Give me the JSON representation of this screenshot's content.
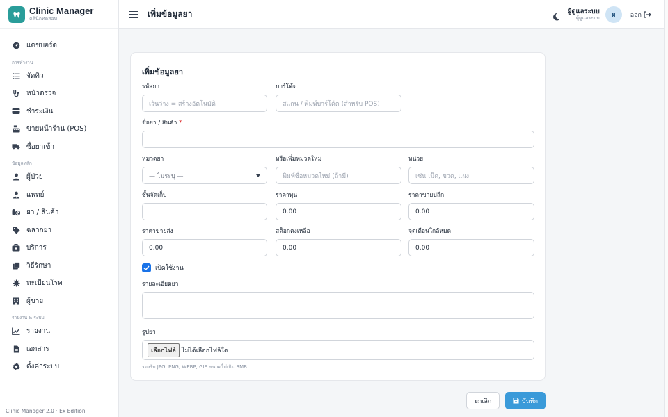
{
  "brand": {
    "title": "Clinic Manager",
    "subtitle": "คลินิกทดสอบ",
    "logo_icon": "tooth-icon"
  },
  "sidebar": {
    "top_item": {
      "label": "แดชบอร์ด",
      "icon": "dashboard-icon"
    },
    "sections": [
      {
        "title": "การทำงาน",
        "items": [
          {
            "label": "จัดคิว",
            "icon": "queue-list-icon"
          },
          {
            "label": "หน้าตรวจ",
            "icon": "stethoscope-icon"
          },
          {
            "label": "ชำระเงิน",
            "icon": "credit-card-icon"
          },
          {
            "label": "ขายหน้าร้าน (POS)",
            "icon": "cash-register-icon"
          },
          {
            "label": "ซื้อยาเข้า",
            "icon": "truck-icon"
          }
        ]
      },
      {
        "title": "ข้อมูลหลัก",
        "items": [
          {
            "label": "ผู้ป่วย",
            "icon": "user-icon"
          },
          {
            "label": "แพทย์",
            "icon": "doctor-icon"
          },
          {
            "label": "ยา / สินค้า",
            "icon": "pills-icon"
          },
          {
            "label": "ฉลากยา",
            "icon": "tag-icon"
          },
          {
            "label": "บริการ",
            "icon": "medkit-icon"
          },
          {
            "label": "วิธีรักษา",
            "icon": "copy-icon"
          },
          {
            "label": "ทะเบียนโรค",
            "icon": "virus-icon"
          },
          {
            "label": "ผู้ขาย",
            "icon": "building-icon"
          }
        ]
      },
      {
        "title": "รายงาน & ระบบ",
        "items": [
          {
            "label": "รายงาน",
            "icon": "chart-line-icon"
          },
          {
            "label": "เอกสาร",
            "icon": "document-icon"
          },
          {
            "label": "ตั้งค่าระบบ",
            "icon": "gear-icon"
          }
        ]
      }
    ],
    "footer": "Clinic Manager 2.0 · Ex Edition"
  },
  "header": {
    "title": "เพิ่มข้อมูลยา",
    "user_name": "ผู้ดูแลระบบ",
    "user_role": "ผู้ดูแลระบบ",
    "avatar_initial": "ผ",
    "logout_label": "ออก"
  },
  "form": {
    "title": "เพิ่มข้อมูลยา",
    "code": {
      "label": "รหัสยา",
      "placeholder": "เว้นว่าง = สร้างอัตโนมัติ"
    },
    "barcode": {
      "label": "บาร์โค้ด",
      "placeholder": "สแกน / พิมพ์บาร์โค้ด (สำหรับ POS)"
    },
    "name": {
      "label": "ชื่อยา / สินค้า",
      "required_mark": "*",
      "value": ""
    },
    "category": {
      "label": "หมวดยา",
      "selected": "— ไม่ระบุ —"
    },
    "new_category": {
      "label": "หรือเพิ่มหมวดใหม่",
      "placeholder": "พิมพ์ชื่อหมวดใหม่ (ถ้ามี)"
    },
    "unit": {
      "label": "หน่วย",
      "placeholder": "เช่น เม็ด, ขวด, แผง"
    },
    "shelf": {
      "label": "ชั้นจัดเก็บ",
      "value": ""
    },
    "cost": {
      "label": "ราคาทุน",
      "value": "0.00"
    },
    "retail": {
      "label": "ราคาขายปลีก",
      "value": "0.00"
    },
    "wholesale": {
      "label": "ราคาขายส่ง",
      "value": "0.00"
    },
    "stock": {
      "label": "สต็อกคงเหลือ",
      "value": "0.00"
    },
    "reorder": {
      "label": "จุดเตือนใกล้หมด",
      "value": "0.00"
    },
    "active": {
      "label": "เปิดใช้งาน",
      "checked": true
    },
    "details": {
      "label": "รายละเอียดยา",
      "value": ""
    },
    "image": {
      "label": "รูปยา",
      "button": "เลือกไฟล์",
      "status": "ไม่ได้เลือกไฟล์ใด",
      "hint": "รองรับ JPG, PNG, WEBP, GIF ขนาดไม่เกิน 3MB"
    }
  },
  "actions": {
    "cancel": "ยกเลิก",
    "save": "บันทึก"
  }
}
